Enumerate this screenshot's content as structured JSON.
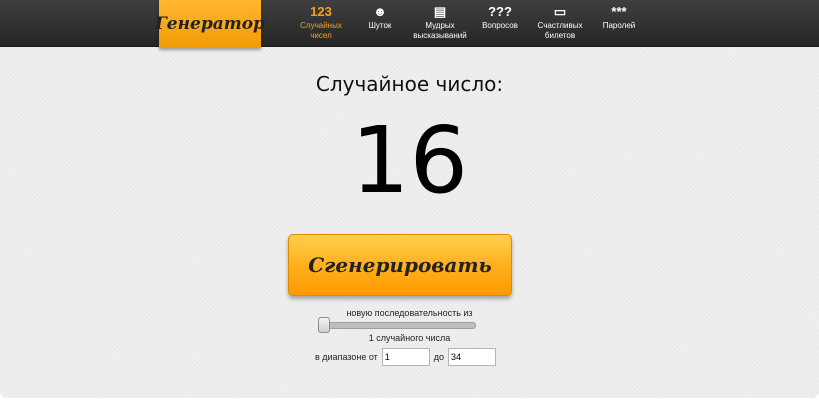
{
  "brand": {
    "logo_text": "Генератор"
  },
  "nav": {
    "items": [
      {
        "icon": "123",
        "label": "Случайных\nчисел",
        "active": true
      },
      {
        "icon": "☻",
        "label": "Шуток"
      },
      {
        "icon": "▤",
        "label": "Мудрых\nвысказываний"
      },
      {
        "icon": "???",
        "label": "Вопросов"
      },
      {
        "icon": "▭",
        "label": "Счастливых\nбилетов"
      },
      {
        "icon": "***",
        "label": "Паролей"
      }
    ]
  },
  "main": {
    "title": "Случайное число:",
    "number": "16",
    "generate_label": "Сгенерировать",
    "sequence_label": "новую последовательность из",
    "count_text": "1 случайного числа",
    "range_from_label": "в диапазоне от",
    "range_to_label": "до",
    "range_from": "1",
    "range_to": "34",
    "slider_fraction": 0
  },
  "colors": {
    "accent": "#f7a219",
    "topbar": "#2f2f2f",
    "button": "#ffb01f"
  }
}
